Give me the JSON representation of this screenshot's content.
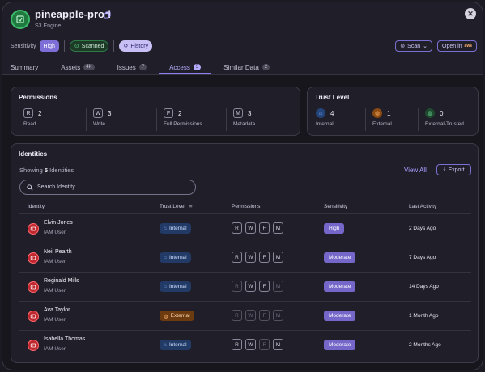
{
  "header": {
    "title": "pineapple-prod",
    "subtitle": "S3 Engine"
  },
  "meta": {
    "sensitivity_label": "Sensitivity",
    "sensitivity_value": "High",
    "scanned_label": "Scanned",
    "history_label": "History",
    "scan_label": "Scan",
    "open_in_label": "Open in"
  },
  "tabs": [
    {
      "label": "Summary",
      "count": ""
    },
    {
      "label": "Assets",
      "count": "4K"
    },
    {
      "label": "Issues",
      "count": "7"
    },
    {
      "label": "Access",
      "count": "5"
    },
    {
      "label": "Similar Data",
      "count": "2"
    }
  ],
  "permissions": {
    "title": "Permissions",
    "items": [
      {
        "key": "R",
        "count": "2",
        "label": "Read"
      },
      {
        "key": "W",
        "count": "3",
        "label": "Write"
      },
      {
        "key": "F",
        "count": "2",
        "label": "Full Permissions"
      },
      {
        "key": "M",
        "count": "3",
        "label": "Metadata"
      }
    ]
  },
  "trust": {
    "title": "Trust Level",
    "items": [
      {
        "count": "4",
        "label": "Internal"
      },
      {
        "count": "1",
        "label": "External"
      },
      {
        "count": "0",
        "label": "External-Trusted"
      }
    ]
  },
  "identities": {
    "title": "Identities",
    "showing_prefix": "Showing",
    "showing_count": "5",
    "showing_suffix": "Identities",
    "view_all": "View All",
    "export": "Export",
    "search_placeholder": "Search Identity",
    "columns": [
      "Identity",
      "Trust Level",
      "Permissions",
      "Sensitivity",
      "Last Activity"
    ],
    "rows": [
      {
        "name": "Elvin Jones",
        "role": "IAM User",
        "trust": "Internal",
        "perms": [
          "R",
          "W",
          "F",
          "M"
        ],
        "perms_on": [
          true,
          true,
          true,
          true
        ],
        "sensitivity": "High",
        "activity": "2 Days Ago"
      },
      {
        "name": "Neil Pearth",
        "role": "IAM User",
        "trust": "Internal",
        "perms": [
          "R",
          "W",
          "F",
          "M"
        ],
        "perms_on": [
          true,
          true,
          true,
          true
        ],
        "sensitivity": "Moderate",
        "activity": "7 Days Ago"
      },
      {
        "name": "Reginald Mills",
        "role": "IAM User",
        "trust": "Internal",
        "perms": [
          "R",
          "W",
          "F",
          "M"
        ],
        "perms_on": [
          false,
          true,
          true,
          false
        ],
        "sensitivity": "Moderate",
        "activity": "14 Days Ago"
      },
      {
        "name": "Ava Taylor",
        "role": "IAM User",
        "trust": "External",
        "perms": [
          "R",
          "W",
          "F",
          "M"
        ],
        "perms_on": [
          false,
          false,
          false,
          false
        ],
        "sensitivity": "Moderate",
        "activity": "1 Month Ago"
      },
      {
        "name": "Isabella Thomas",
        "role": "IAM User",
        "trust": "Internal",
        "perms": [
          "R",
          "W",
          "F",
          "M"
        ],
        "perms_on": [
          true,
          true,
          false,
          true
        ],
        "sensitivity": "Moderate",
        "activity": "2 Months Ago"
      }
    ]
  },
  "colors": {
    "accent": "#8b7ff0",
    "high": "#7d6dd6",
    "internal": "#213a66",
    "external": "#6b3a0f"
  }
}
